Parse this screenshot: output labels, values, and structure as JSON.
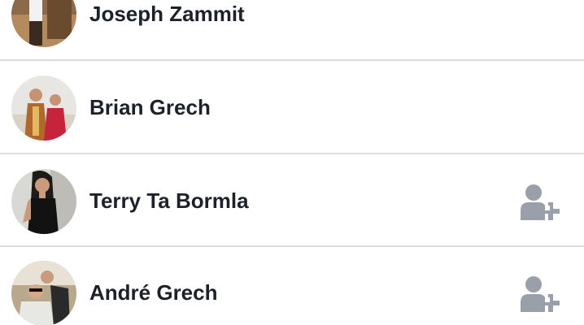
{
  "friends": [
    {
      "name": "Joseph Zammit",
      "has_add_button": false
    },
    {
      "name": "Brian Grech",
      "has_add_button": false
    },
    {
      "name": "Terry Ta Bormla",
      "has_add_button": true
    },
    {
      "name": "André Grech",
      "has_add_button": true
    }
  ],
  "colors": {
    "name_text": "#1d2129",
    "divider": "#dcdde0",
    "add_icon": "#9aa0aa"
  },
  "icons": {
    "add_friend": "add-friend-icon"
  }
}
